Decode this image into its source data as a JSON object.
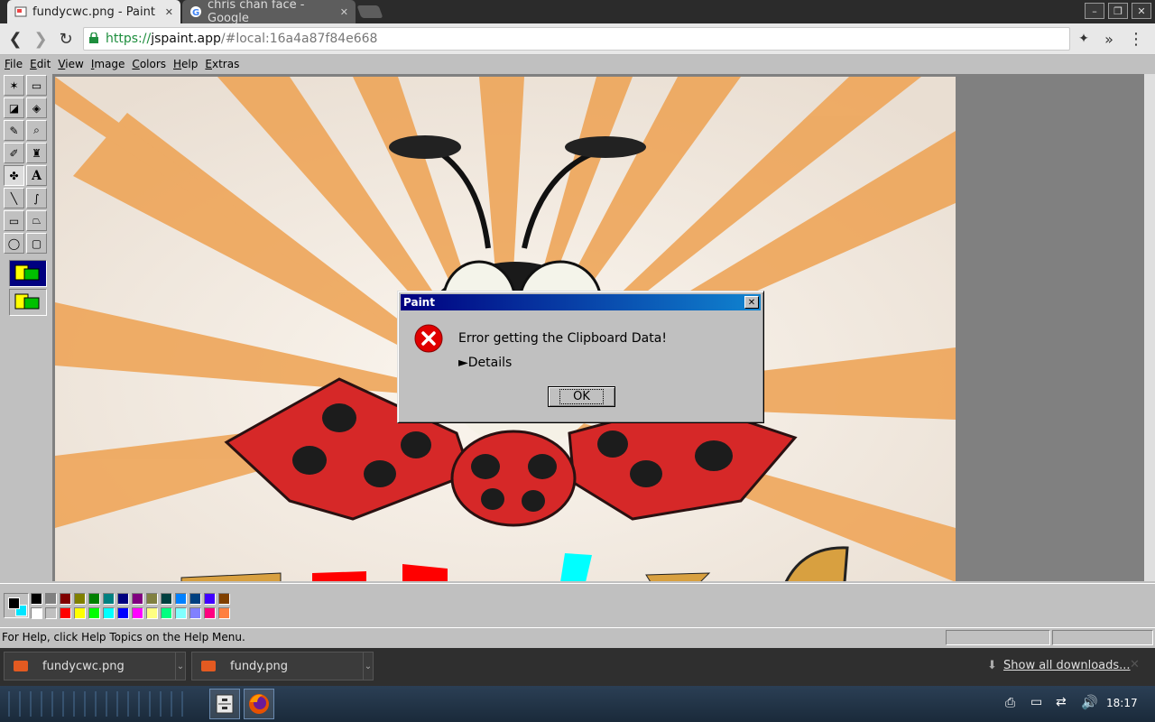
{
  "browser": {
    "tabs": [
      {
        "title": "fundycwc.png - Paint",
        "active": true,
        "close": "✕"
      },
      {
        "title": "chris chan face - Google",
        "active": false,
        "close": "✕"
      }
    ],
    "url": {
      "scheme": "https://",
      "host": "jspaint.app",
      "path": "/#local:16a4a87f84e668"
    },
    "window_controls": {
      "minimize": "–",
      "restore": "❐",
      "close": "✕"
    },
    "nav": {
      "back": "❮",
      "forward": "❯",
      "reload": "↻",
      "extensions": "✦",
      "overflow": "»",
      "menu": "⋮"
    }
  },
  "menubar": [
    "File",
    "Edit",
    "View",
    "Image",
    "Colors",
    "Help",
    "Extras"
  ],
  "tools": [
    {
      "name": "free-form-select",
      "glyph": "✶"
    },
    {
      "name": "select",
      "glyph": "▭"
    },
    {
      "name": "eraser",
      "glyph": "◪"
    },
    {
      "name": "fill",
      "glyph": "◈"
    },
    {
      "name": "pick-color",
      "glyph": "✎"
    },
    {
      "name": "magnifier",
      "glyph": "⌕"
    },
    {
      "name": "pencil",
      "glyph": "✐"
    },
    {
      "name": "brush",
      "glyph": "♜"
    },
    {
      "name": "airbrush",
      "glyph": "✤"
    },
    {
      "name": "text",
      "glyph": "A"
    },
    {
      "name": "line",
      "glyph": "╲"
    },
    {
      "name": "curve",
      "glyph": "∫"
    },
    {
      "name": "rectangle",
      "glyph": "▭"
    },
    {
      "name": "polygon",
      "glyph": "⏢"
    },
    {
      "name": "ellipse",
      "glyph": "◯"
    },
    {
      "name": "rounded-rectangle",
      "glyph": "▢"
    }
  ],
  "colors": {
    "top": [
      "#000000",
      "#808080",
      "#800000",
      "#808000",
      "#008000",
      "#008080",
      "#000080",
      "#800080",
      "#808040",
      "#004040",
      "#0080ff",
      "#004080",
      "#4000ff",
      "#804000"
    ],
    "bottom": [
      "#ffffff",
      "#c0c0c0",
      "#ff0000",
      "#ffff00",
      "#00ff00",
      "#00ffff",
      "#0000ff",
      "#ff00ff",
      "#ffff80",
      "#00ff80",
      "#80ffff",
      "#8080ff",
      "#ff0080",
      "#ff8040"
    ],
    "primary": "#000000",
    "secondary": "#00e5ff"
  },
  "status": {
    "help": "For Help, click Help Topics on the Help Menu."
  },
  "dialog": {
    "title": "Paint",
    "message": "Error getting the Clipboard Data!",
    "details": "►Details",
    "ok": "OK",
    "close": "✕"
  },
  "downloads": {
    "items": [
      "fundycwc.png",
      "fundy.png"
    ],
    "show_all": "Show all downloads...",
    "close": "✕"
  },
  "taskbar": {
    "clock": "18:17"
  }
}
